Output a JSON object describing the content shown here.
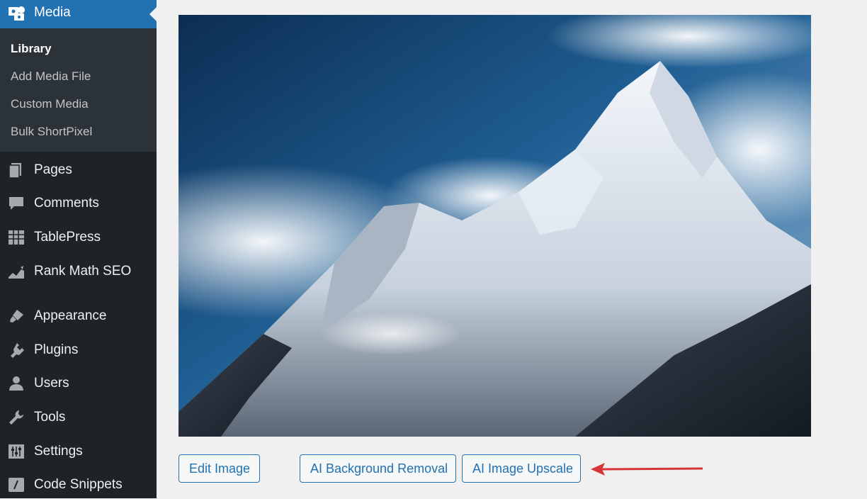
{
  "sidebar": {
    "media_label": "Media",
    "submenu": [
      "Library",
      "Add Media File",
      "Custom Media",
      "Bulk ShortPixel"
    ],
    "items": [
      {
        "label": "Pages",
        "icon": "pages-icon"
      },
      {
        "label": "Comments",
        "icon": "comments-icon"
      },
      {
        "label": "TablePress",
        "icon": "tablepress-icon"
      },
      {
        "label": "Rank Math SEO",
        "icon": "rank-math-icon"
      },
      {
        "label": "Appearance",
        "icon": "appearance-icon"
      },
      {
        "label": "Plugins",
        "icon": "plugins-icon"
      },
      {
        "label": "Users",
        "icon": "users-icon"
      },
      {
        "label": "Tools",
        "icon": "tools-icon"
      },
      {
        "label": "Settings",
        "icon": "settings-icon"
      },
      {
        "label": "Code Snippets",
        "icon": "code-snippets-icon"
      }
    ]
  },
  "main": {
    "image_subject": "snow-covered mountain peak under a blue sky",
    "buttons": {
      "edit": "Edit Image",
      "bg_removal": "AI Background Removal",
      "upscale": "AI Image Upscale"
    }
  },
  "colors": {
    "sidebar_bg": "#1d2327",
    "submenu_bg": "#2c3338",
    "accent": "#2271b1",
    "arrow": "#d63638"
  }
}
